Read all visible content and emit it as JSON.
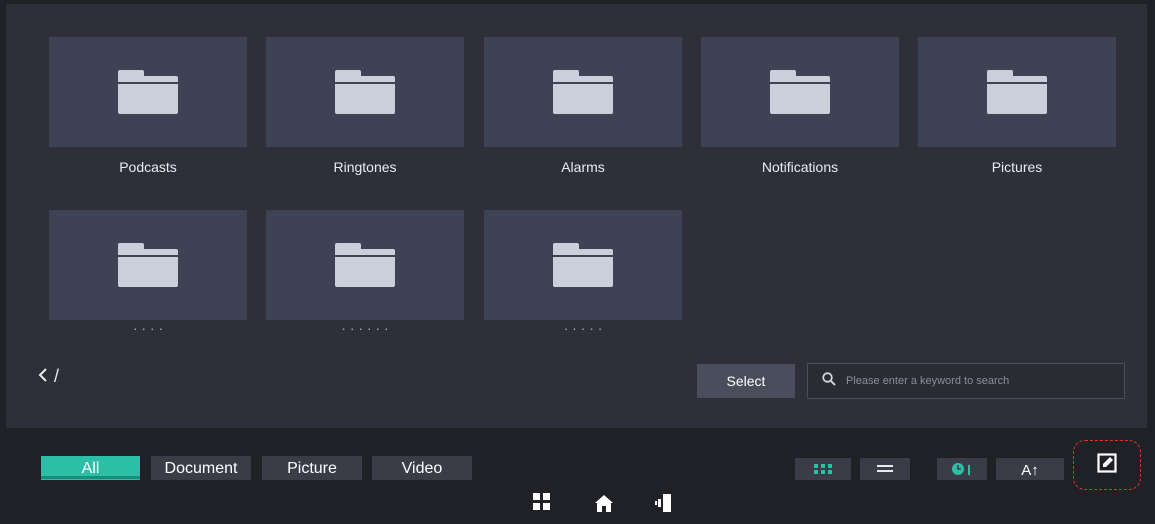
{
  "folders_row1": [
    {
      "label": "Podcasts"
    },
    {
      "label": "Ringtones"
    },
    {
      "label": "Alarms"
    },
    {
      "label": "Notifications"
    },
    {
      "label": "Pictures"
    }
  ],
  "folders_row2": [
    {
      "label": "· · · ·"
    },
    {
      "label": "· · · · · ·"
    },
    {
      "label": "· · · · ·"
    }
  ],
  "path": {
    "back_icon": "chevron-left-icon",
    "current": "/"
  },
  "select_label": "Select",
  "search": {
    "placeholder": "Please enter a keyword to search",
    "icon": "search-icon"
  },
  "filter_tabs": [
    {
      "label": "All",
      "active": true
    },
    {
      "label": "Document",
      "active": false
    },
    {
      "label": "Picture",
      "active": false
    },
    {
      "label": "Video",
      "active": false
    }
  ],
  "view_controls": {
    "sort_name_label": "A↑"
  },
  "colors": {
    "accent": "#2bbfa8",
    "highlight_dashed": "#e6332a",
    "tile": "#3d4354",
    "panel": "#2e2f38"
  }
}
